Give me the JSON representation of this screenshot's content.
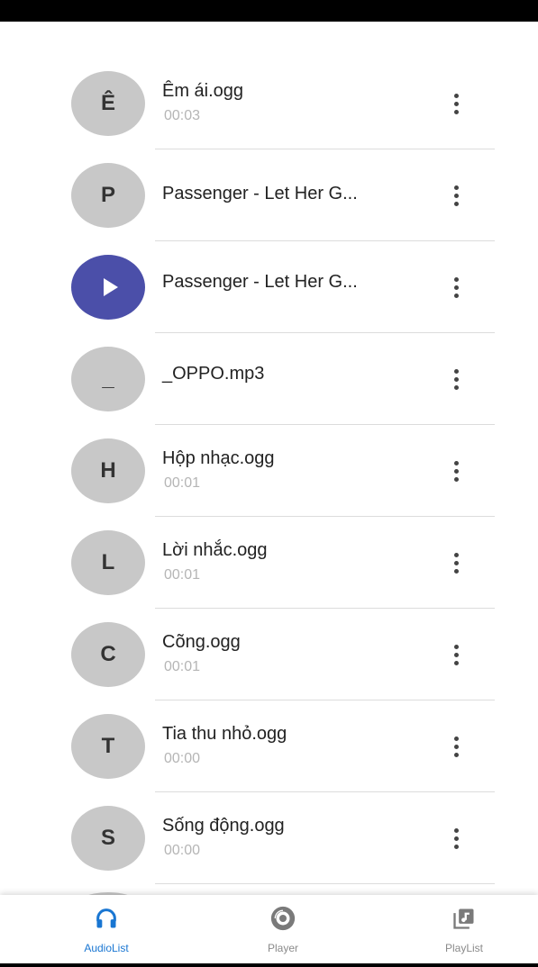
{
  "tracks": [
    {
      "initial": "Ê",
      "title": "Êm ái.ogg",
      "duration": "00:03"
    },
    {
      "initial": "P",
      "title": "Passenger - Let Her G...",
      "duration": ""
    },
    {
      "initial": "",
      "title": "Passenger - Let Her G...",
      "duration": "",
      "playing": true
    },
    {
      "initial": "_",
      "title": "_OPPO.mp3",
      "duration": ""
    },
    {
      "initial": "H",
      "title": "Hộp nhạc.ogg",
      "duration": "00:01"
    },
    {
      "initial": "L",
      "title": "Lời nhắc.ogg",
      "duration": "00:01"
    },
    {
      "initial": "C",
      "title": "Cõng.ogg",
      "duration": "00:01"
    },
    {
      "initial": "T",
      "title": "Tia thu nhỏ.ogg",
      "duration": "00:00"
    },
    {
      "initial": "S",
      "title": "Sống động.ogg",
      "duration": "00:00"
    }
  ],
  "colors": {
    "accent": "#1976d2",
    "playing": "#4b4fa9",
    "avatar_bg": "#c8c8c8"
  },
  "bottom_nav": {
    "items": [
      {
        "label": "AudioList",
        "icon": "headphones-icon",
        "active": true
      },
      {
        "label": "Player",
        "icon": "disc-icon",
        "active": false
      },
      {
        "label": "PlayList",
        "icon": "playlist-icon",
        "active": false
      }
    ]
  }
}
